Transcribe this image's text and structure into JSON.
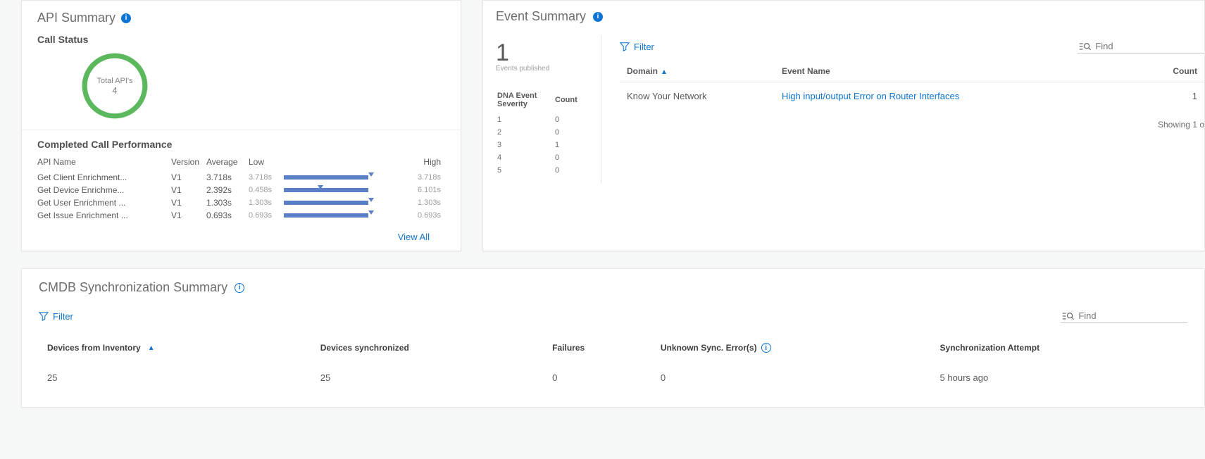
{
  "api_summary": {
    "title": "API Summary",
    "call_status_title": "Call Status",
    "donut_label": "Total API's",
    "donut_value": "4",
    "perf_title": "Completed Call Performance",
    "headers": {
      "name": "API Name",
      "version": "Version",
      "avg": "Average",
      "low": "Low",
      "high": "High"
    },
    "rows": [
      {
        "name": "Get Client Enrichment...",
        "version": "V1",
        "avg": "3.718s",
        "low": "3.718s",
        "high": "3.718s",
        "fill_left": 0,
        "fill_width": 100,
        "marker": 100
      },
      {
        "name": "Get Device Enrichme...",
        "version": "V1",
        "avg": "2.392s",
        "low": "0.458s",
        "high": "6.101s",
        "fill_left": 0,
        "fill_width": 100,
        "marker": 40
      },
      {
        "name": "Get User Enrichment ...",
        "version": "V1",
        "avg": "1.303s",
        "low": "1.303s",
        "high": "1.303s",
        "fill_left": 0,
        "fill_width": 100,
        "marker": 100
      },
      {
        "name": "Get Issue Enrichment ...",
        "version": "V1",
        "avg": "0.693s",
        "low": "0.693s",
        "high": "0.693s",
        "fill_left": 0,
        "fill_width": 100,
        "marker": 100
      }
    ],
    "view_all": "View All"
  },
  "event_summary": {
    "title": "Event Summary",
    "big_count": "1",
    "big_count_sub": "Events published",
    "severity_headers": {
      "sev": "DNA Event Severity",
      "count": "Count"
    },
    "severity_rows": [
      {
        "sev": "1",
        "count": "0"
      },
      {
        "sev": "2",
        "count": "0"
      },
      {
        "sev": "3",
        "count": "1"
      },
      {
        "sev": "4",
        "count": "0"
      },
      {
        "sev": "5",
        "count": "0"
      }
    ],
    "filter_label": "Filter",
    "find_placeholder": "Find",
    "table_headers": {
      "domain": "Domain",
      "event_name": "Event Name",
      "count": "Count"
    },
    "rows": [
      {
        "domain": "Know Your Network",
        "event_name": "High input/output Error on Router Interfaces",
        "count": "1"
      }
    ],
    "paging_text": "Showing 1 o"
  },
  "cmdb": {
    "title": "CMDB Synchronization Summary",
    "filter_label": "Filter",
    "find_placeholder": "Find",
    "headers": {
      "inventory": "Devices from Inventory",
      "synced": "Devices synchronized",
      "failures": "Failures",
      "unknown": "Unknown Sync. Error(s)",
      "attempt": "Synchronization Attempt"
    },
    "row": {
      "inventory": "25",
      "synced": "25",
      "failures": "0",
      "unknown": "0",
      "attempt": "5 hours ago"
    }
  }
}
